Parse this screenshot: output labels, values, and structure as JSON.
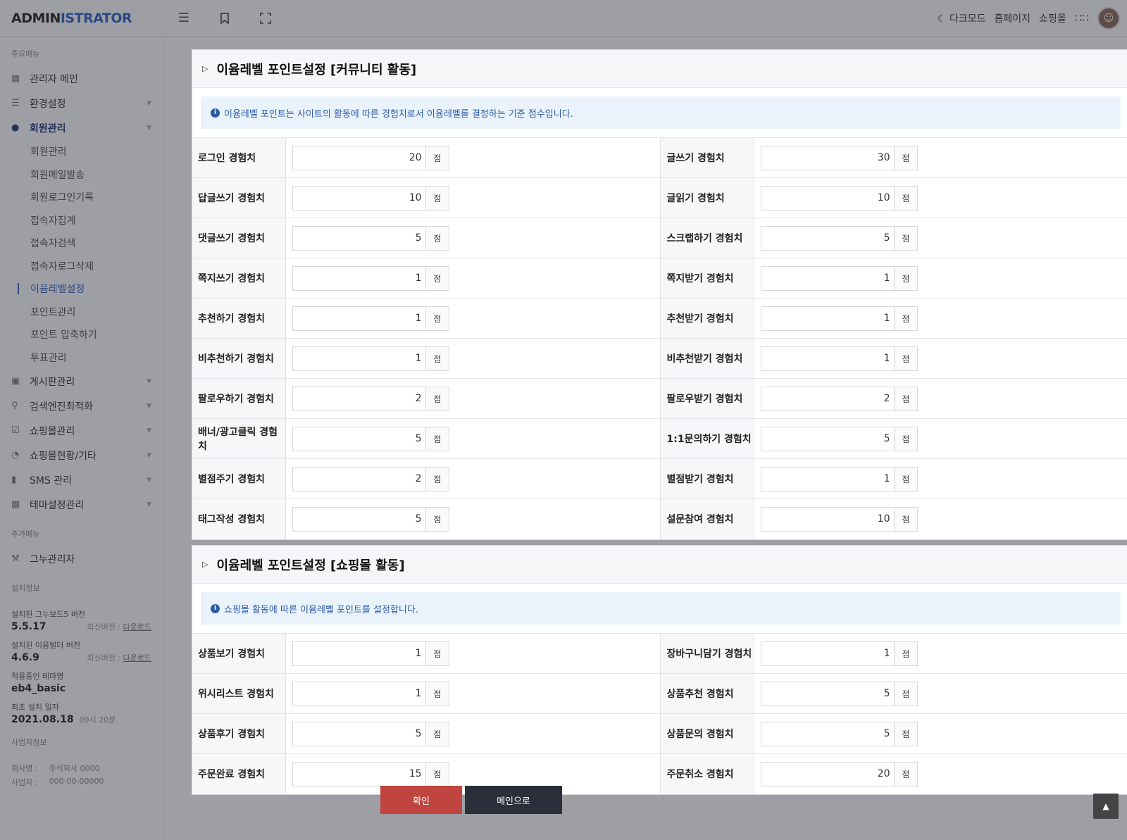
{
  "header": {
    "logo_main": "ADMIN",
    "logo_accent": "ISTRATOR",
    "dark_mode": "다크모드",
    "homepage": "홈페이지",
    "shop": "쇼핑몰"
  },
  "sidebar": {
    "main_menu_label": "주요메뉴",
    "items": [
      {
        "label": "관리자 메인"
      },
      {
        "label": "환경설정"
      },
      {
        "label": "회원관리"
      }
    ],
    "member_sub": [
      {
        "label": "회원관리"
      },
      {
        "label": "회원메일발송"
      },
      {
        "label": "회원로그인기록"
      },
      {
        "label": "접속자집계"
      },
      {
        "label": "접속자검색"
      },
      {
        "label": "접속자로그삭제"
      },
      {
        "label": "이윰레벨설정"
      },
      {
        "label": "포인트관리"
      },
      {
        "label": "포인트 압축하기"
      },
      {
        "label": "투표관리"
      }
    ],
    "items2": [
      {
        "label": "게시판관리"
      },
      {
        "label": "검색엔진최적화"
      },
      {
        "label": "쇼핑몰관리"
      },
      {
        "label": "쇼핑몰현황/기타"
      },
      {
        "label": "SMS 관리"
      },
      {
        "label": "테마설정관리"
      }
    ],
    "extra_menu_label": "추가메뉴",
    "extra_item": "그누관리자",
    "install_label": "설치정보",
    "gnu_label": "설치된 그누보드5 버전",
    "gnu_ver": "5.5.17",
    "gnu_latest": "최신버전 : ",
    "download": "다운로드",
    "eyoom_label": "설치된 이윰빌더 버전",
    "eyoom_ver": "4.6.9",
    "theme_label": "적용중인 테마명",
    "theme_val": "eb4_basic",
    "first_label": "최초 설치 일자",
    "first_date": "2021.08.18",
    "first_time": "09시 20분",
    "biz_label": "사업자정보",
    "company_key": "회사명 :",
    "company_val": "주식회사 0000",
    "bizno_key": "사업자 :",
    "bizno_val": "000-00-00000"
  },
  "community": {
    "title": "이윰레벨 포인트설정 [커뮤니티 활동]",
    "notice": "이윰레벨 포인트는 사이트의 활동에 따른 경험치로서 이윰레벨를 결정하는 기준 점수입니다.",
    "rows": [
      [
        {
          "label": "로그인 경험치",
          "value": "20"
        },
        {
          "label": "글쓰기 경험치",
          "value": "30"
        }
      ],
      [
        {
          "label": "답글쓰기 경험치",
          "value": "10"
        },
        {
          "label": "글읽기 경험치",
          "value": "10"
        }
      ],
      [
        {
          "label": "댓글쓰기 경험치",
          "value": "5"
        },
        {
          "label": "스크랩하기 경험치",
          "value": "5"
        }
      ],
      [
        {
          "label": "쪽지쓰기 경험치",
          "value": "1"
        },
        {
          "label": "쪽지받기 경험치",
          "value": "1"
        }
      ],
      [
        {
          "label": "추천하기 경험치",
          "value": "1"
        },
        {
          "label": "추천받기 경험치",
          "value": "1"
        }
      ],
      [
        {
          "label": "비추천하기 경험치",
          "value": "1"
        },
        {
          "label": "비추천받기 경험치",
          "value": "1"
        }
      ],
      [
        {
          "label": "팔로우하기 경험치",
          "value": "2"
        },
        {
          "label": "팔로우받기 경험치",
          "value": "2"
        }
      ],
      [
        {
          "label": "배너/광고클릭 경험치",
          "value": "5"
        },
        {
          "label": "1:1문의하기 경험치",
          "value": "5"
        }
      ],
      [
        {
          "label": "별점주기 경험치",
          "value": "2"
        },
        {
          "label": "별점받기 경험치",
          "value": "1"
        }
      ],
      [
        {
          "label": "태그작성 경험치",
          "value": "5"
        },
        {
          "label": "설문참여 경험치",
          "value": "10"
        }
      ]
    ]
  },
  "shop": {
    "title": "이윰레벨 포인트설정 [쇼핑몰 활동]",
    "notice": "쇼핑몰 활동에 따른 이윰레벨 포인트를 설정합니다.",
    "rows": [
      [
        {
          "label": "상품보기 경험치",
          "value": "1"
        },
        {
          "label": "장바구니담기 경험치",
          "value": "1"
        }
      ],
      [
        {
          "label": "위시리스트 경험치",
          "value": "1"
        },
        {
          "label": "상품추천 경험치",
          "value": "5"
        }
      ],
      [
        {
          "label": "상품후기 경험치",
          "value": "5"
        },
        {
          "label": "상품문의 경험치",
          "value": "5"
        }
      ],
      [
        {
          "label": "주문완료 경험치",
          "value": "15"
        },
        {
          "label": "주문취소 경험치",
          "value": "20"
        }
      ]
    ]
  },
  "unit": "점",
  "buttons": {
    "confirm": "확인",
    "main": "메인으로"
  }
}
